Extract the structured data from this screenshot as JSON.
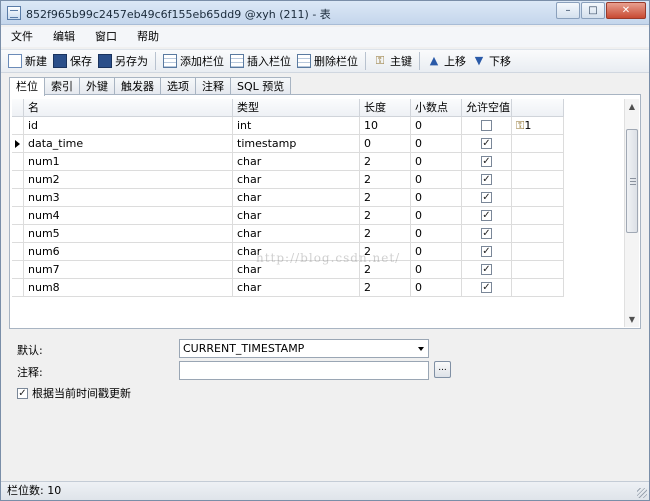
{
  "window": {
    "title": "852f965b99c2457eb49c6f155eb65dd9 @xyh (211) - 表",
    "minimize": "–",
    "maximize": "□",
    "close": "✕"
  },
  "menu": [
    "文件",
    "编辑",
    "窗口",
    "帮助"
  ],
  "toolbar": {
    "new": "新建",
    "save": "保存",
    "save_as": "另存为",
    "add_column": "添加栏位",
    "insert_column": "插入栏位",
    "delete_column": "删除栏位",
    "primary_key": "主键",
    "move_up": "上移",
    "move_down": "下移"
  },
  "tabs": [
    "栏位",
    "索引",
    "外键",
    "触发器",
    "选项",
    "注释",
    "SQL 预览"
  ],
  "grid": {
    "headers": {
      "name": "名",
      "type": "类型",
      "length": "长度",
      "decimals": "小数点",
      "allow_null": "允许空值 ("
    },
    "rows": [
      {
        "name": "id",
        "type": "int",
        "length": "10",
        "decimals": "0",
        "allow_null": false,
        "key": "1"
      },
      {
        "name": "data_time",
        "type": "timestamp",
        "length": "0",
        "decimals": "0",
        "allow_null": true,
        "key": ""
      },
      {
        "name": "num1",
        "type": "char",
        "length": "2",
        "decimals": "0",
        "allow_null": true,
        "key": ""
      },
      {
        "name": "num2",
        "type": "char",
        "length": "2",
        "decimals": "0",
        "allow_null": true,
        "key": ""
      },
      {
        "name": "num3",
        "type": "char",
        "length": "2",
        "decimals": "0",
        "allow_null": true,
        "key": ""
      },
      {
        "name": "num4",
        "type": "char",
        "length": "2",
        "decimals": "0",
        "allow_null": true,
        "key": ""
      },
      {
        "name": "num5",
        "type": "char",
        "length": "2",
        "decimals": "0",
        "allow_null": true,
        "key": ""
      },
      {
        "name": "num6",
        "type": "char",
        "length": "2",
        "decimals": "0",
        "allow_null": true,
        "key": ""
      },
      {
        "name": "num7",
        "type": "char",
        "length": "2",
        "decimals": "0",
        "allow_null": true,
        "key": ""
      },
      {
        "name": "num8",
        "type": "char",
        "length": "2",
        "decimals": "0",
        "allow_null": true,
        "key": ""
      }
    ]
  },
  "props": {
    "default_label": "默认:",
    "default_value": "CURRENT_TIMESTAMP",
    "comment_label": "注释:",
    "ellipsis": "...",
    "update_label": "根据当前时间戳更新",
    "update_checked": true
  },
  "status": "栏位数: 10",
  "watermark": "http://blog.csdn.net/"
}
